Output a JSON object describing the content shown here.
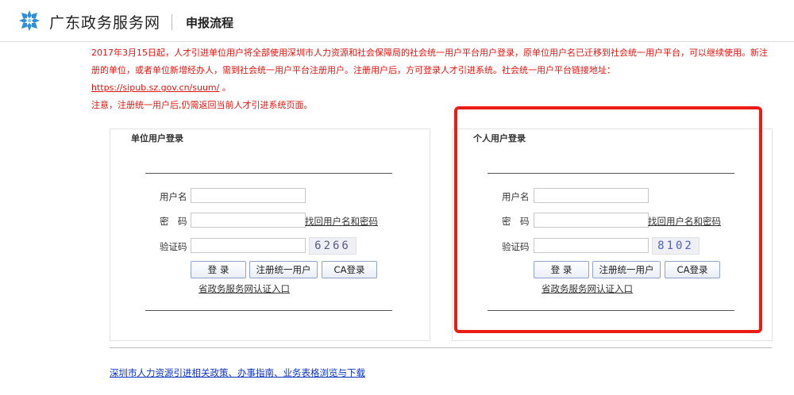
{
  "header": {
    "logo_icon": "snowflake-emblem-icon",
    "site_title": "广东政务服务网",
    "page_title": "申报流程"
  },
  "notice": {
    "line1": "2017年3月15日起，人才引进单位用户将全部使用深圳市人力资源和社会保障局的社会统一用户平台用户登录，原单位用户名已迁移到社会统一用户平台，可以继续使用。新注册的单位，或者单位新增经办人，需到社会统一用户平台注册用户。注册用户后，方可登录人才引进系统。社会统一用户平台链接地址：",
    "url": "https://sipub.sz.gov.cn/suum/",
    "url_suffix": "。",
    "line2": "注意，注册统一用户后,仍需返回当前人才引进系统页面。"
  },
  "unit_login": {
    "title": "单位用户登录",
    "username_label": "用户名",
    "username_value": "",
    "password_label": "密　码",
    "password_value": "",
    "recover_link": "找回用户名和密码",
    "captcha_label": "验证码",
    "captcha_value": "",
    "captcha_text": "6266",
    "login_button": "登 录",
    "register_button": "注册统一用户",
    "ca_button": "CA登录",
    "portal_link": "省政务服务网认证入口"
  },
  "personal_login": {
    "title": "个人用户登录",
    "username_label": "用户名",
    "username_value": "",
    "password_label": "密　码",
    "password_value": "",
    "recover_link": "找回用户名和密码",
    "captcha_label": "验证码",
    "captcha_value": "",
    "captcha_text": "8102",
    "login_button": "登 录",
    "register_button": "注册统一用户",
    "ca_button": "CA登录",
    "portal_link": "省政务服务网认证入口"
  },
  "footer": {
    "link": "深圳市人力资源引进相关政策、办事指南、业务表格浏览与下载"
  },
  "colors": {
    "notice_red": "#e2140e",
    "highlight_red": "#ea1c13",
    "footer_link_blue": "#0b34c7",
    "logo_blue": "#2f8fd8"
  }
}
